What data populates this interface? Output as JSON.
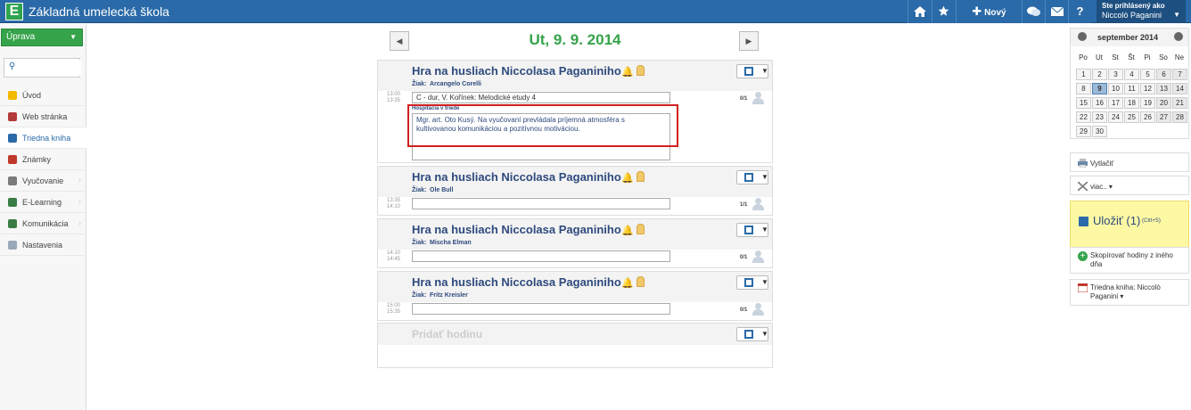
{
  "app": {
    "logo_letter": "E",
    "title": "Základná umelecká škola"
  },
  "topbar": {
    "home_icon": "home-icon",
    "favorite_icon": "star-icon",
    "new_item_label": "Nový prvok",
    "chat_icon": "chat-icon",
    "mail_icon": "mail-icon",
    "help_label": "?",
    "user_caption": "Ste prihlásený ako",
    "user_name": "Niccolò Paganini"
  },
  "sidebar": {
    "edit_label": "Úprava",
    "search_placeholder": "",
    "items": [
      {
        "label": "Úvod",
        "icon": "star-icon",
        "color": "#f5b800",
        "active": false,
        "has_children": false
      },
      {
        "label": "Web stránka",
        "icon": "web-icon",
        "color": "#b33a3a",
        "active": false,
        "has_children": false
      },
      {
        "label": "Triedna kniha",
        "icon": "book-icon",
        "color": "#2a6aa8",
        "active": true,
        "has_children": false
      },
      {
        "label": "Známky",
        "icon": "grades-icon",
        "color": "#c0392b",
        "active": false,
        "has_children": false
      },
      {
        "label": "Vyučovanie",
        "icon": "teaching-icon",
        "color": "#7a7a7a",
        "active": false,
        "has_children": true
      },
      {
        "label": "E-Learning",
        "icon": "elearning-icon",
        "color": "#3a7d44",
        "active": false,
        "has_children": true
      },
      {
        "label": "Komunikácia",
        "icon": "communication-icon",
        "color": "#3a7d44",
        "active": false,
        "has_children": true
      },
      {
        "label": "Nastavenia",
        "icon": "settings-icon",
        "color": "#9aa9b8",
        "active": false,
        "has_children": false
      }
    ]
  },
  "day": {
    "prev_label": "◀",
    "next_label": "▶",
    "title": "Ut, 9. 9. 2014"
  },
  "lessons": [
    {
      "title": "Hra na husliach  Niccolasa Paganiniho",
      "student_label": "Žiak:",
      "student": "Arcangelo Corelli",
      "time_start": "13:00",
      "time_end": "13:35",
      "topic": "C - dur, V. Kořínek: Melodické etudy 4",
      "count": "0/1",
      "observation_label": "Hospitácia v triede",
      "observation_text": "Mgr. art. Oto Kusý. Na vyučovaní prevládala príjemná atmosféra s kultivovanou komunikáciou a pozitívnou motiváciou."
    },
    {
      "title": "Hra na husliach  Niccolasa Paganiniho",
      "student_label": "Žiak:",
      "student": "Ole Bull",
      "time_start": "13:35",
      "time_end": "14:10",
      "topic": "",
      "count": "1/1"
    },
    {
      "title": "Hra na husliach  Niccolasa Paganiniho",
      "student_label": "Žiak:",
      "student": "Mischa Elman",
      "time_start": "14:10",
      "time_end": "14:45",
      "topic": "",
      "count": "0/1"
    },
    {
      "title": "Hra na husliach  Niccolasa Paganiniho",
      "student_label": "Žiak:",
      "student": "Fritz Kreisler",
      "time_start": "15:00",
      "time_end": "15:35",
      "topic": "",
      "count": "0/1"
    }
  ],
  "add_lesson_label": "Pridať hodinu",
  "calendar": {
    "month": "september 2014",
    "dow": [
      "Po",
      "Ut",
      "St",
      "Št",
      "Pi",
      "So",
      "Ne"
    ],
    "weeks": [
      [
        "1",
        "2",
        "3",
        "4",
        "5",
        "6",
        "7"
      ],
      [
        "8",
        "9",
        "10",
        "11",
        "12",
        "13",
        "14"
      ],
      [
        "15",
        "16",
        "17",
        "18",
        "19",
        "20",
        "21"
      ],
      [
        "22",
        "23",
        "24",
        "25",
        "26",
        "27",
        "28"
      ],
      [
        "29",
        "30",
        "",
        "",
        "",
        "",
        ""
      ]
    ],
    "today": "9"
  },
  "actions": {
    "print_label": "Vytlačiť",
    "more_label": "viac.. ▾",
    "save_label": "Uložiť (1)",
    "save_hint": "(Ctrl+S)",
    "copy_label": "Skopírovať hodiny z iného dňa",
    "classbook_label": "Triedna kniha: Niccolò Paganini ▾"
  },
  "colors": {
    "topbar": "#2a6aa8",
    "accent_green": "#35a34a",
    "title_blue": "#2e4a7d",
    "save_bg": "#fdf8a4",
    "highlight": "#d01f1f"
  }
}
